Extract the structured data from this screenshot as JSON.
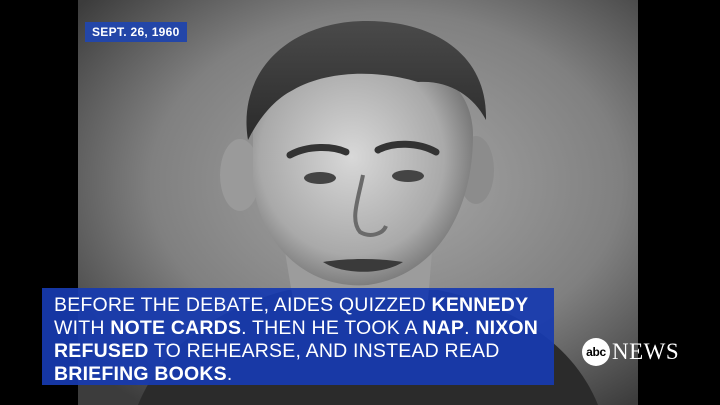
{
  "date_tag": "SEPT. 26, 1960",
  "caption": {
    "segments": [
      {
        "text": "BEFORE THE DEBATE, AIDES QUIZZED ",
        "bold": false
      },
      {
        "text": "KENNEDY",
        "bold": true
      },
      {
        "text": " WITH ",
        "bold": false
      },
      {
        "text": "NOTE CARDS",
        "bold": true
      },
      {
        "text": ". THEN HE TOOK A ",
        "bold": false
      },
      {
        "text": "NAP",
        "bold": true
      },
      {
        "text": ". ",
        "bold": false
      },
      {
        "text": "NIXON",
        "bold": true
      },
      {
        "text": " ",
        "bold": false
      },
      {
        "text": "REFUSED",
        "bold": true
      },
      {
        "text": " TO REHEARSE, AND INSTEAD READ ",
        "bold": false
      },
      {
        "text": "BRIEFING BOOKS",
        "bold": true
      },
      {
        "text": ".",
        "bold": false
      }
    ]
  },
  "logo": {
    "abc": "abc",
    "news": "NEWS"
  },
  "colors": {
    "caption_bg": "#173aaf",
    "date_tag_bg": "#2346a8"
  }
}
